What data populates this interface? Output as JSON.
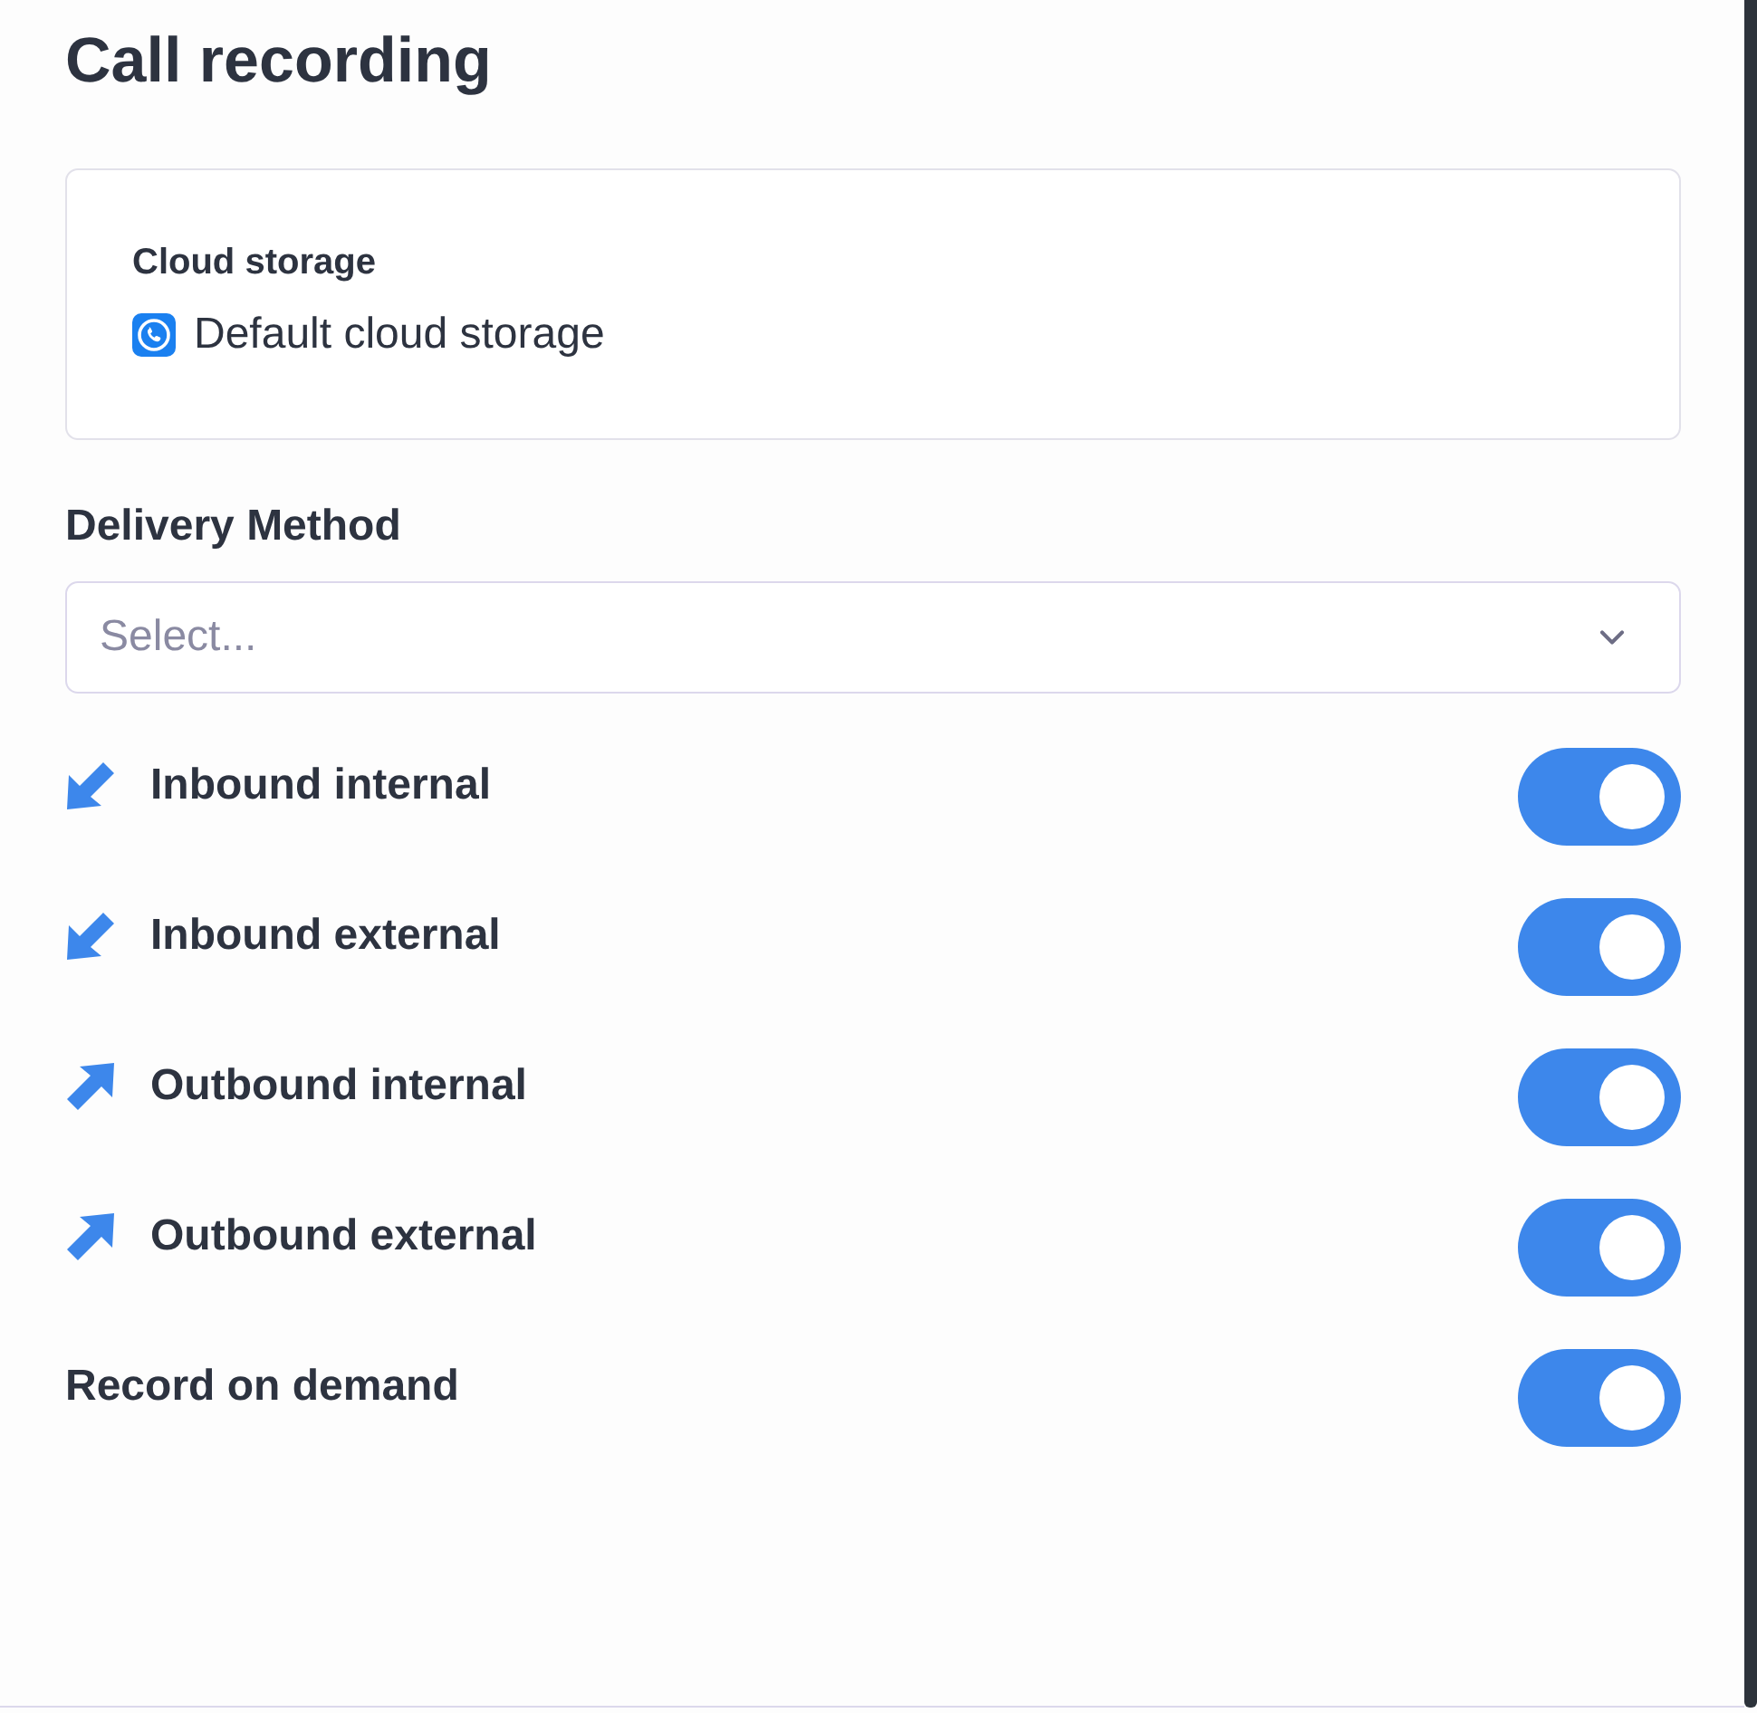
{
  "title": "Call recording",
  "storage": {
    "label": "Cloud storage",
    "value": "Default cloud storage"
  },
  "delivery": {
    "label": "Delivery Method",
    "placeholder": "Select..."
  },
  "toggles": [
    {
      "kind": "inbound",
      "label": "Inbound internal",
      "on": true
    },
    {
      "kind": "inbound",
      "label": "Inbound external",
      "on": true
    },
    {
      "kind": "outbound",
      "label": "Outbound internal",
      "on": true
    },
    {
      "kind": "outbound",
      "label": "Outbound external",
      "on": true
    },
    {
      "kind": "plain",
      "label": "Record on demand",
      "on": true
    }
  ]
}
